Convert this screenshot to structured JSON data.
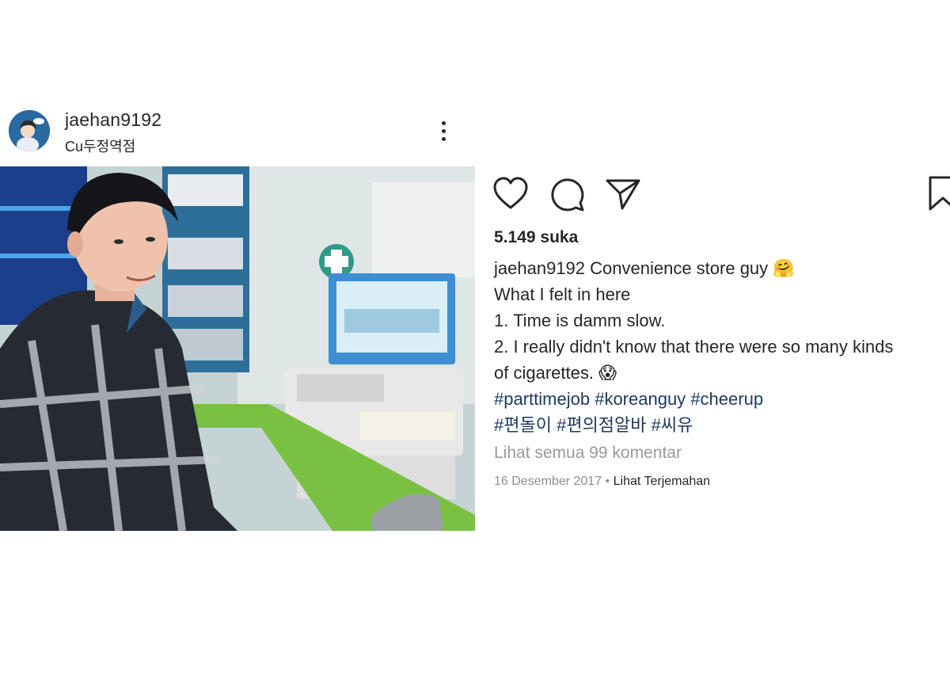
{
  "post": {
    "username": "jaehan9192",
    "location": "Cu두정역점"
  },
  "actions": {
    "icons": [
      "heart-icon",
      "comment-icon",
      "share-icon",
      "bookmark-icon"
    ]
  },
  "likes": "5.149 suka",
  "caption": {
    "username": "jaehan9192",
    "line1_text": "Convenience store guy 🤗",
    "line2": "What I felt in here",
    "line3": "1. Time is damm slow.",
    "line4": "2. I really didn't know that there were so many kinds",
    "line5": "of cigarettes. 😱",
    "hashtags_row1": [
      "#parttimejob",
      "#koreanguy",
      "#cheerup"
    ],
    "hashtags_row2": [
      "#편돌이",
      "#편의점알바",
      "#씨유"
    ]
  },
  "view_comments": "Lihat semua 99 komentar",
  "date": "16 Desember 2017",
  "separator": "•",
  "translate": "Lihat Terjemahan",
  "colors": {
    "text": "#262626",
    "hashtag": "#1e3a60",
    "muted": "#8e8e8e",
    "store_green": "#7ac143"
  }
}
